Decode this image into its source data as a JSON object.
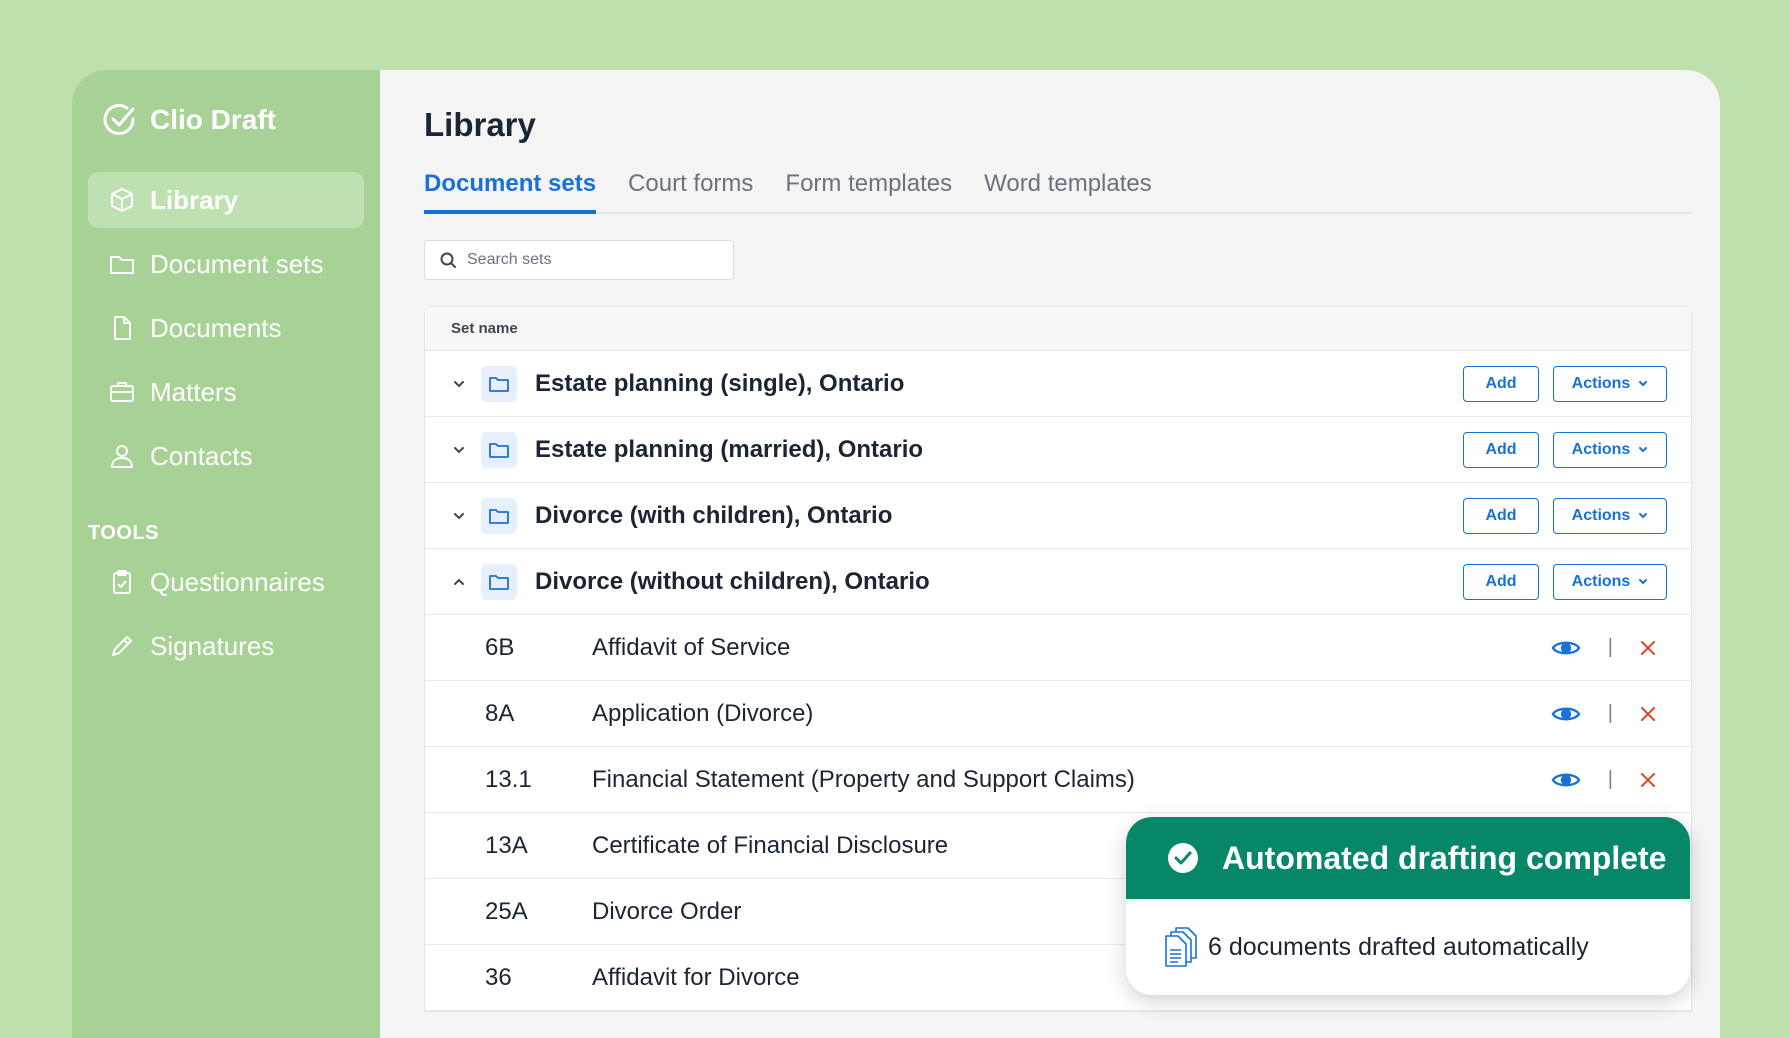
{
  "app": {
    "name": "Clio Draft"
  },
  "sidebar": {
    "items": [
      {
        "label": "Library",
        "icon": "cube-icon",
        "active": true
      },
      {
        "label": "Document sets",
        "icon": "folder-icon",
        "active": false
      },
      {
        "label": "Documents",
        "icon": "document-icon",
        "active": false
      },
      {
        "label": "Matters",
        "icon": "briefcase-icon",
        "active": false
      },
      {
        "label": "Contacts",
        "icon": "person-icon",
        "active": false
      }
    ],
    "tools_label": "TOOLS",
    "tools": [
      {
        "label": "Questionnaires",
        "icon": "clipboard-check-icon"
      },
      {
        "label": "Signatures",
        "icon": "pen-icon"
      }
    ]
  },
  "main": {
    "title": "Library",
    "tabs": [
      {
        "label": "Document sets",
        "active": true
      },
      {
        "label": "Court forms",
        "active": false
      },
      {
        "label": "Form templates",
        "active": false
      },
      {
        "label": "Word templates",
        "active": false
      }
    ],
    "search": {
      "placeholder": "Search sets",
      "value": ""
    },
    "table": {
      "header": "Set name",
      "add_label": "Add",
      "actions_label": "Actions",
      "sets": [
        {
          "name": "Estate planning (single), Ontario",
          "expanded": false
        },
        {
          "name": "Estate planning (married), Ontario",
          "expanded": false
        },
        {
          "name": "Divorce (with children), Ontario",
          "expanded": false
        },
        {
          "name": "Divorce (without children), Ontario",
          "expanded": true
        }
      ],
      "documents": [
        {
          "code": "6B",
          "name": "Affidavit of Service"
        },
        {
          "code": "8A",
          "name": "Application (Divorce)"
        },
        {
          "code": "13.1",
          "name": "Financial Statement (Property and Support Claims)"
        },
        {
          "code": "13A",
          "name": "Certificate of Financial Disclosure"
        },
        {
          "code": "25A",
          "name": "Divorce Order"
        },
        {
          "code": "36",
          "name": "Affidavit for Divorce"
        }
      ],
      "separator": "|"
    }
  },
  "toast": {
    "title": "Automated drafting complete",
    "message": "6 documents drafted automatically"
  },
  "colors": {
    "accent": "#1871d6",
    "sidebar": "#a8d295",
    "toast": "#058768",
    "danger": "#e0442b"
  }
}
